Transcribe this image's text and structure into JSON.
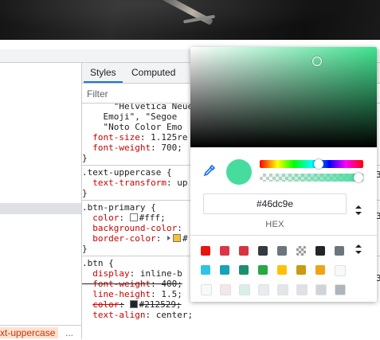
{
  "tabs": [
    {
      "label": "Styles",
      "active": true
    },
    {
      "label": "Computed",
      "active": false
    }
  ],
  "filter": {
    "placeholder": "Filter"
  },
  "breadcrumb": {
    "current": "xt-uppercase",
    "more": "..."
  },
  "styles": {
    "font_rule": {
      "lines": [
        "\"Helvetica Neue\",",
        "Emoji\", \"Segoe",
        "\"Noto Color Emo"
      ],
      "font_size_prop": "font-size",
      "font_size_val": "1.125re",
      "font_weight_prop": "font-weight",
      "font_weight_val": "700;",
      "close": "}"
    },
    "text_uppercase": {
      "selector": ".text-uppercase {",
      "prop": "text-transform",
      "val": "up",
      "close": "}",
      "right_frag": "3"
    },
    "btn_primary": {
      "selector": ".btn-primary {",
      "color_prop": "color",
      "color_val": "#fff;",
      "bg_prop": "background-color",
      "border_prop": "border-color",
      "border_val": "#",
      "close": "}",
      "right_frag": "3"
    },
    "btn": {
      "selector": ".btn {",
      "display_prop": "display",
      "display_val": "inline-b",
      "fw_prop": "font-weight",
      "fw_val": "400;",
      "lh_prop": "line-height",
      "lh_val": "1.5;",
      "color_prop": "color",
      "color_val": "#212529;",
      "ta_prop": "text-align",
      "ta_val": "center;",
      "right_frag": "3"
    }
  },
  "picker": {
    "hex_value": "#46dc9e",
    "format_label": "HEX",
    "current_color": "#46dc9e",
    "hue_position_pct": 57,
    "alpha_position_pct": 100,
    "swatches": [
      [
        "#e8160f",
        "#dc3545",
        "#d73441",
        "#343a40",
        "#6c757d",
        "checker",
        "#212529",
        "#6c757d"
      ],
      [
        "#2ec4e8",
        "#17a2b8",
        "#1b8f6e",
        "#28a745",
        "#ffc107",
        "#c99a14",
        "#f0a318",
        "#f8f9fa"
      ],
      [
        "#f8f9fa",
        "#f5e6e8",
        "#d8eee8",
        "#e9ecef",
        "#e3e6e9",
        "#dee2e6",
        "#ced4da",
        "#adb5bd"
      ]
    ]
  }
}
